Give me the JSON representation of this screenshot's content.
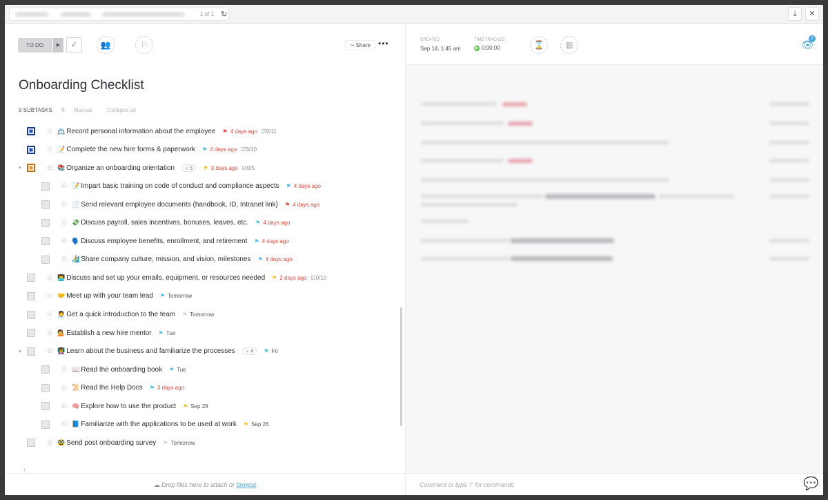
{
  "topbar": {
    "page_count": "1 of 1",
    "refresh_icon": "refresh-icon",
    "download_icon": "download-icon",
    "close_icon": "close-icon"
  },
  "toolbar": {
    "status_label": "TO DO",
    "share_label": "Share",
    "more_label": "•••"
  },
  "task": {
    "title": "Onboarding Checklist",
    "subtask_count": "9 SUBTASKS",
    "sort_label": "Manual",
    "collapse_label": "Collapse all"
  },
  "subtasks": [
    {
      "level": 0,
      "check": "blue",
      "emoji": "📇",
      "name": "Record personal information about the employee",
      "flag_color": "#e5483d",
      "due": "4 days ago",
      "due_style": "red",
      "checklist": "0/11"
    },
    {
      "level": 0,
      "check": "blue",
      "emoji": "📝",
      "name": "Complete the new hire forms & paperwork",
      "flag_color": "#4fc1e9",
      "due": "4 days ago",
      "due_style": "red",
      "checklist": "3/10"
    },
    {
      "level": 0,
      "check": "orange",
      "expanded": true,
      "emoji": "📚",
      "name": "Organize an onboarding orientation",
      "count": "5",
      "flag_color": "#f7c325",
      "due": "3 days ago",
      "due_style": "red",
      "checklist": "0/5"
    },
    {
      "level": 1,
      "check": "grey",
      "emoji": "📝",
      "name": "Impart basic training on code of conduct and compliance aspects",
      "flag_color": "#4fc1e9",
      "due": "4 days ago",
      "due_style": "red"
    },
    {
      "level": 1,
      "check": "grey",
      "emoji": "📄",
      "name": "Send relevant employee documents (handbook, ID, Intranet link)",
      "flag_color": "#e5483d",
      "due": "4 days ago",
      "due_style": "red"
    },
    {
      "level": 1,
      "check": "grey",
      "emoji": "💸",
      "name": "Discuss payroll, sales incentives, bonuses, leaves, etc.",
      "flag_color": "#4fc1e9",
      "due": "4 days ago",
      "due_style": "red"
    },
    {
      "level": 1,
      "check": "grey",
      "emoji": "🗣️",
      "name": "Discuss employee benefits, enrollment, and retirement",
      "flag_color": "#4fc1e9",
      "due": "4 days ago",
      "due_style": "red"
    },
    {
      "level": 1,
      "check": "grey",
      "emoji": "🏄",
      "name": "Share company culture, mission, and vision, milestones",
      "flag_color": "#4fc1e9",
      "due": "4 days ago",
      "due_style": "red"
    },
    {
      "level": 0,
      "check": "grey",
      "emoji": "👨‍💻",
      "name": "Discuss and set up your emails, equipment, or resources needed",
      "flag_color": "#f7c325",
      "due": "2 days ago",
      "due_style": "red",
      "checklist": "0/10"
    },
    {
      "level": 0,
      "check": "grey",
      "emoji": "🤝",
      "name": "Meet up with your team lead",
      "flag_color": "#4fc1e9",
      "due": "Tomorrow",
      "due_style": "grey"
    },
    {
      "level": 0,
      "check": "grey",
      "emoji": "🧑‍💼",
      "name": "Get a quick introduction to the team",
      "flag_color": "#d3d3d6",
      "due": "Tomorrow",
      "due_style": "grey"
    },
    {
      "level": 0,
      "check": "grey",
      "emoji": "💁",
      "name": "Establish a new hire mentor",
      "flag_color": "#4fc1e9",
      "due": "Tue",
      "due_style": "grey"
    },
    {
      "level": 0,
      "check": "grey",
      "expanded": true,
      "emoji": "👩‍🏫",
      "name": "Learn about the business and familiarize the processes",
      "count": "4",
      "flag_color": "#4fc1e9",
      "due": "Fri",
      "due_style": "grey"
    },
    {
      "level": 1,
      "check": "grey",
      "emoji": "📖",
      "name": "Read the onboarding book",
      "flag_color": "#4fc1e9",
      "due": "Tue",
      "due_style": "grey"
    },
    {
      "level": 1,
      "check": "grey",
      "emoji": "📜",
      "name": "Read the Help Docs",
      "flag_color": "#4fc1e9",
      "due": "3 days ago",
      "due_style": "red"
    },
    {
      "level": 1,
      "check": "grey",
      "emoji": "🧠",
      "name": "Explore how to use the product",
      "flag_color": "#f7c325",
      "due": "Sep 28",
      "due_style": "grey"
    },
    {
      "level": 1,
      "check": "grey",
      "emoji": "📘",
      "name": "Familiarize with the applications to be used at work",
      "flag_color": "#f7c325",
      "due": "Sep 26",
      "due_style": "grey"
    },
    {
      "level": 0,
      "check": "grey",
      "emoji": "🥸",
      "name": "Send post onboarding survey",
      "flag_color": "#d3d3d6",
      "due": "Tomorrow",
      "due_style": "grey"
    }
  ],
  "attach": {
    "drop_text": "Drop files here to attach or ",
    "browse_link": "browse"
  },
  "details": {
    "created_label": "CREATED",
    "created_value": "Sep 14, 1:45 am",
    "time_label": "TIME TRACKED",
    "time_value": "0:00:00",
    "watchers_count": "2",
    "comment_placeholder": "Comment or type '/' for commands"
  }
}
